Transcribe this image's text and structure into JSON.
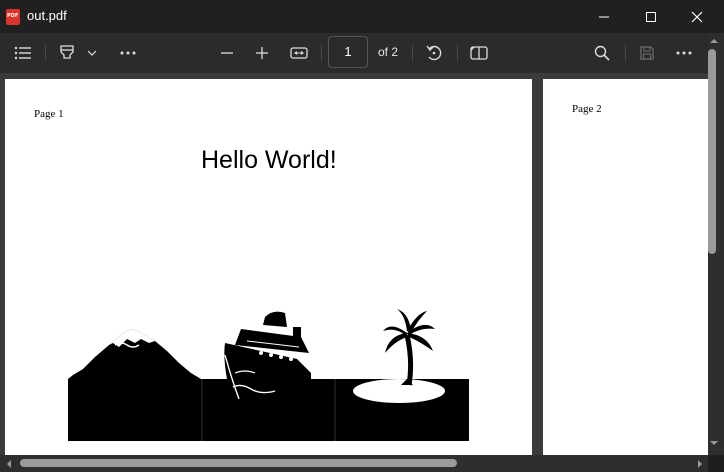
{
  "window": {
    "title": "out.pdf",
    "app_icon_text": "PDF"
  },
  "toolbar": {
    "page_current": "1",
    "page_total_label": "of 2",
    "items": [
      "contents-icon",
      "highlight-icon",
      "more-icon",
      "zoom-out-icon",
      "zoom-in-icon",
      "fit-width-icon",
      "rotate-icon",
      "page-view-icon",
      "search-icon",
      "save-icon",
      "more-icon"
    ]
  },
  "document": {
    "page1": {
      "label": "Page 1",
      "heading": "Hello World!"
    },
    "page2": {
      "label": "Page 2"
    }
  },
  "colors": {
    "accent": "#d9342b",
    "background": "#202020",
    "page": "#ffffff"
  }
}
